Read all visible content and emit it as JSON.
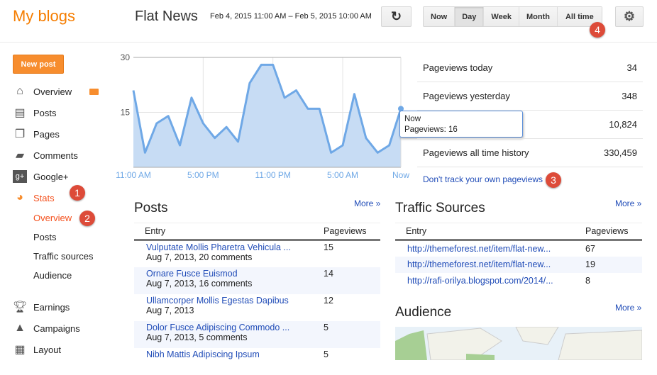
{
  "header": {
    "logo": "My blogs",
    "blog_name": "Flat News",
    "date_range": "Feb 4, 2015 11:00 AM – Feb 5, 2015 10:00 AM",
    "refresh_icon": "refresh-icon",
    "ranges": [
      "Now",
      "Day",
      "Week",
      "Month",
      "All time"
    ],
    "active_range": "Day",
    "settings_icon": "gear-icon"
  },
  "sidebar": {
    "new_post": "New post",
    "items": [
      {
        "label": "Overview",
        "icon": "home-icon"
      },
      {
        "label": "Posts",
        "icon": "posts-icon"
      },
      {
        "label": "Pages",
        "icon": "pages-icon"
      },
      {
        "label": "Comments",
        "icon": "comment-icon"
      },
      {
        "label": "Google+",
        "icon": "google-plus-icon"
      },
      {
        "label": "Stats",
        "icon": "pie-chart-icon"
      }
    ],
    "stats_sub": [
      "Overview",
      "Posts",
      "Traffic sources",
      "Audience"
    ],
    "items2": [
      {
        "label": "Earnings",
        "icon": "trophy-icon"
      },
      {
        "label": "Campaigns",
        "icon": "campaigns-icon"
      },
      {
        "label": "Layout",
        "icon": "layout-icon"
      }
    ]
  },
  "badges": [
    "1",
    "2",
    "3",
    "4"
  ],
  "chart_data": {
    "type": "area",
    "x_ticks": [
      "11:00 AM",
      "5:00 PM",
      "11:00 PM",
      "5:00 AM",
      "Now"
    ],
    "y_ticks": [
      15,
      30
    ],
    "ylim": [
      0,
      30
    ],
    "values": [
      21,
      4,
      12,
      14,
      6,
      19,
      12,
      8,
      11,
      7,
      23,
      28,
      28,
      19,
      21,
      16,
      16,
      4,
      6,
      20,
      8,
      4,
      6,
      16
    ],
    "color": "#6fa8e6",
    "grid": true
  },
  "tooltip": {
    "title": "Now",
    "text": "Pageviews: 16"
  },
  "stats": [
    {
      "label": "Pageviews today",
      "value": "34"
    },
    {
      "label": "Pageviews yesterday",
      "value": "348"
    },
    {
      "label": "",
      "value": "10,824"
    },
    {
      "label": "Pageviews all time history",
      "value": "330,459"
    }
  ],
  "dont_track": "Don't track your own pageviews",
  "posts": {
    "title": "Posts",
    "more": "More »",
    "col_entry": "Entry",
    "col_views": "Pageviews",
    "rows": [
      {
        "title": "Vulputate Mollis Pharetra Vehicula ...",
        "meta": "Aug 7, 2013, 20 comments",
        "views": "15"
      },
      {
        "title": "Ornare Fusce Euismod",
        "meta": "Aug 7, 2013, 16 comments",
        "views": "14"
      },
      {
        "title": "Ullamcorper Mollis Egestas Dapibus",
        "meta": "Aug 7, 2013",
        "views": "12"
      },
      {
        "title": "Dolor Fusce Adipiscing Commodo ...",
        "meta": "Aug 7, 2013, 5 comments",
        "views": "5"
      },
      {
        "title": "Nibh Mattis Adipiscing Ipsum",
        "meta": "",
        "views": "5"
      }
    ]
  },
  "traffic": {
    "title": "Traffic Sources",
    "more": "More »",
    "col_entry": "Entry",
    "col_views": "Pageviews",
    "rows": [
      {
        "url": "http://themeforest.net/item/flat-new...",
        "views": "67"
      },
      {
        "url": "http://themeforest.net/item/flat-new...",
        "views": "19"
      },
      {
        "url": "http://rafi-orilya.blogspot.com/2014/...",
        "views": "8"
      }
    ]
  },
  "audience": {
    "title": "Audience",
    "more": "More »"
  }
}
